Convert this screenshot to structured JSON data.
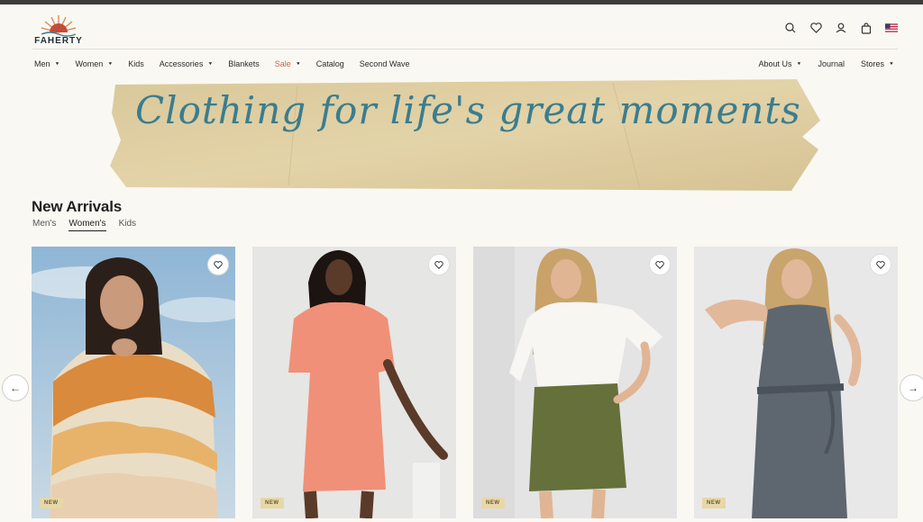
{
  "brand": {
    "name": "FAHERTY"
  },
  "utilities": [
    "search-icon",
    "heart-icon",
    "account-icon",
    "bag-icon",
    "us-flag-icon"
  ],
  "nav": {
    "left": [
      {
        "label": "Men",
        "dropdown": true
      },
      {
        "label": "Women",
        "dropdown": true
      },
      {
        "label": "Kids",
        "dropdown": false
      },
      {
        "label": "Accessories",
        "dropdown": true
      },
      {
        "label": "Blankets",
        "dropdown": false
      },
      {
        "label": "Sale",
        "dropdown": true
      },
      {
        "label": "Catalog",
        "dropdown": false
      },
      {
        "label": "Second Wave",
        "dropdown": false
      }
    ],
    "right": [
      {
        "label": "About Us",
        "dropdown": true
      },
      {
        "label": "Journal",
        "dropdown": false
      },
      {
        "label": "Stores",
        "dropdown": true
      }
    ]
  },
  "banner": {
    "text": "Clothing for life's great moments"
  },
  "new_arrivals": {
    "title": "New Arrivals",
    "tabs": [
      {
        "label": "Men's",
        "active": false
      },
      {
        "label": "Women's",
        "active": true
      },
      {
        "label": "Kids",
        "active": false
      }
    ],
    "products": [
      {
        "badge": "NEW",
        "image": "model-in-striped-hoodie"
      },
      {
        "badge": "NEW",
        "image": "model-in-coral-dress"
      },
      {
        "badge": "NEW",
        "image": "model-in-white-top-olive-skirt"
      },
      {
        "badge": "NEW",
        "image": "model-in-grey-jumpsuit"
      }
    ]
  },
  "colors": {
    "accent": "#3a7d8f",
    "sale": "#c06b4a",
    "badge": "#e8d7a8",
    "background": "#faf8f3"
  },
  "carousel": {
    "prev": "←",
    "next": "→"
  }
}
